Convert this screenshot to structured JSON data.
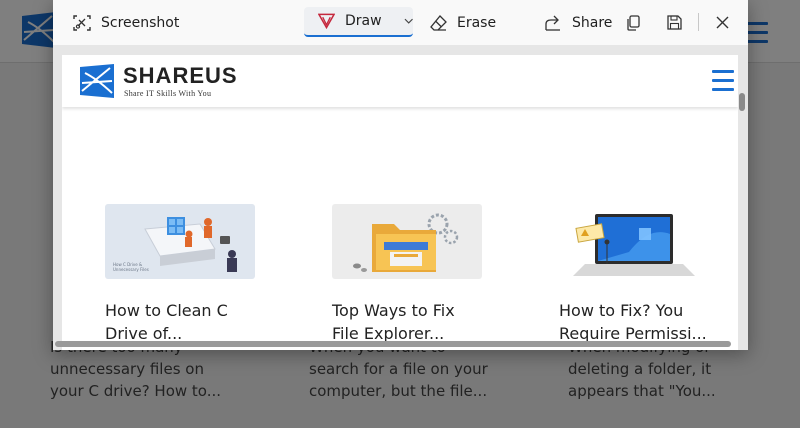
{
  "toolbar": {
    "screenshot_label": "Screenshot",
    "draw_label": "Draw",
    "erase_label": "Erase",
    "share_label": "Share"
  },
  "site": {
    "brand_name": "SHAREUS",
    "tagline": "Share IT Skills With You"
  },
  "cards": [
    {
      "title_line1": "How to Clean C",
      "title_line2": "Drive of..."
    },
    {
      "title_line1": "Top Ways to Fix",
      "title_line2": "File Explorer..."
    },
    {
      "title_line1": "How to Fix? You",
      "title_line2": "Require Permissi..."
    }
  ],
  "background_snippets": [
    {
      "line1": "Is there too many",
      "line2": "unnecessary files on",
      "line3": "your C drive? How to..."
    },
    {
      "line1": "When you want to",
      "line2": "search for a file on your",
      "line3": "computer, but the file..."
    },
    {
      "line1": "When modifying or",
      "line2": "deleting a folder, it",
      "line3": "appears that \"You..."
    }
  ],
  "colors": {
    "accent": "#1a6fd1",
    "toolbar_bg": "#f9f9f9",
    "draw_icon": "#c5283d"
  }
}
